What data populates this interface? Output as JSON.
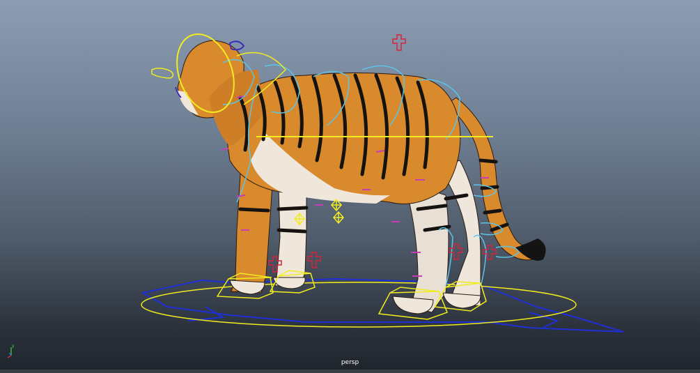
{
  "viewport": {
    "camera_name": "persp",
    "background_top": "#8c9db3",
    "background_bottom": "#20252d"
  },
  "axis_gizmo": {
    "x_axis_color": "#e23b3b",
    "y_axis_color": "#3fe03f",
    "z_axis_color": "#3b5fe2",
    "y_label": "y"
  },
  "rig": {
    "main_control_color": "#f1ec1f",
    "ik_control_color": "#f1ec1f",
    "fk_control_color": "#5cc4e6",
    "pole_vector_color": "#d9223b",
    "ground_control_color": "#1f2fd6",
    "joint_marker_color": "#c83cb8"
  },
  "subject": {
    "name_icon": "tiger-model"
  }
}
